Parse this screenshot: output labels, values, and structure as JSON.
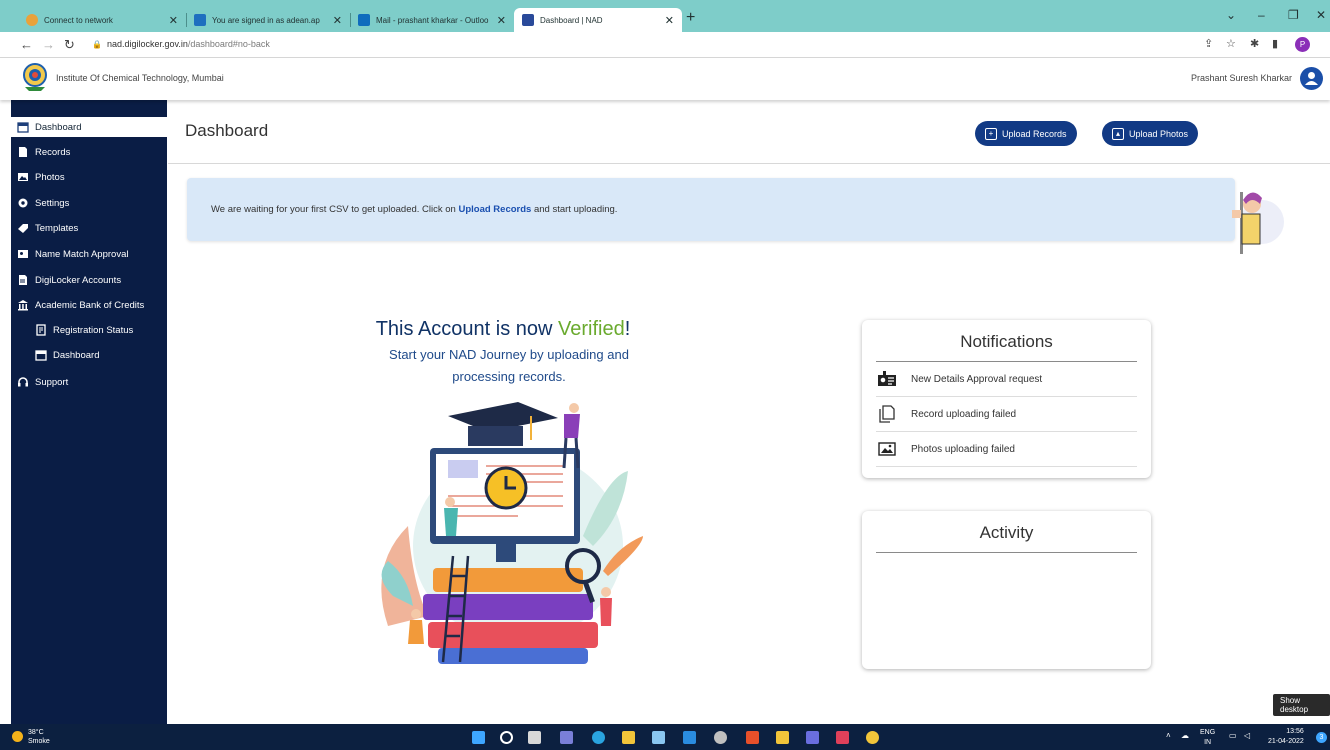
{
  "browser": {
    "tabs": [
      {
        "title": "Connect to network",
        "active": false
      },
      {
        "title": "You are signed in as adean.ap",
        "active": false
      },
      {
        "title": "Mail - prashant kharkar - Outloo",
        "active": false
      },
      {
        "title": "Dashboard | NAD",
        "active": true
      }
    ],
    "url_domain": "nad.digilocker.gov.in",
    "url_path": "/dashboard#no-back",
    "profile_initial": "P",
    "new_tab_symbol": "+"
  },
  "header": {
    "institution": "Institute Of Chemical Technology, Mumbai",
    "user_name": "Prashant Suresh Kharkar"
  },
  "sidebar": {
    "items": [
      {
        "label": "Dashboard",
        "icon": "calendar-icon",
        "active": true
      },
      {
        "label": "Records",
        "icon": "file-icon"
      },
      {
        "label": "Photos",
        "icon": "photos-icon"
      },
      {
        "label": "Settings",
        "icon": "gear-icon"
      },
      {
        "label": "Templates",
        "icon": "tag-icon"
      },
      {
        "label": "Name Match Approval",
        "icon": "id-card-icon"
      },
      {
        "label": "DigiLocker Accounts",
        "icon": "document-icon"
      },
      {
        "label": "Academic Bank of Credits",
        "icon": "bank-icon"
      },
      {
        "label": "Registration Status",
        "icon": "clipboard-icon",
        "sub": true
      },
      {
        "label": "Dashboard",
        "icon": "calendar-icon",
        "sub": true
      },
      {
        "label": "Support",
        "icon": "headset-icon"
      }
    ]
  },
  "main": {
    "title": "Dashboard",
    "upload_records_label": "Upload Records",
    "upload_photos_label": "Upload Photos",
    "banner_before": "We are waiting for your first CSV to get uploaded. Click on ",
    "banner_link": "Upload Records",
    "banner_after": " and start uploading.",
    "verified_prefix": "This Account is now ",
    "verified_word": "Verified",
    "verified_suffix": "!",
    "journey_line1": "Start your NAD Journey by uploading and",
    "journey_line2": "processing records."
  },
  "notifications": {
    "title": "Notifications",
    "items": [
      {
        "label": "New Details Approval request",
        "icon": "approval-icon"
      },
      {
        "label": "Record uploading failed",
        "icon": "copy-icon"
      },
      {
        "label": "Photos uploading failed",
        "icon": "image-icon"
      }
    ]
  },
  "activity": {
    "title": "Activity"
  },
  "taskbar": {
    "temperature": "38°C",
    "weather": "Smoke",
    "language": "ENG",
    "region": "IN",
    "time": "13:56",
    "date": "21-04-2022",
    "badge": "3",
    "show_desktop": "Show desktop"
  },
  "colors": {
    "sidebar_bg": "#0a1d45",
    "primary_button": "#123a85",
    "verified_green": "#6aaa2e",
    "banner_bg": "#d9e8f8",
    "tabbar_bg": "#7ecdc9"
  }
}
